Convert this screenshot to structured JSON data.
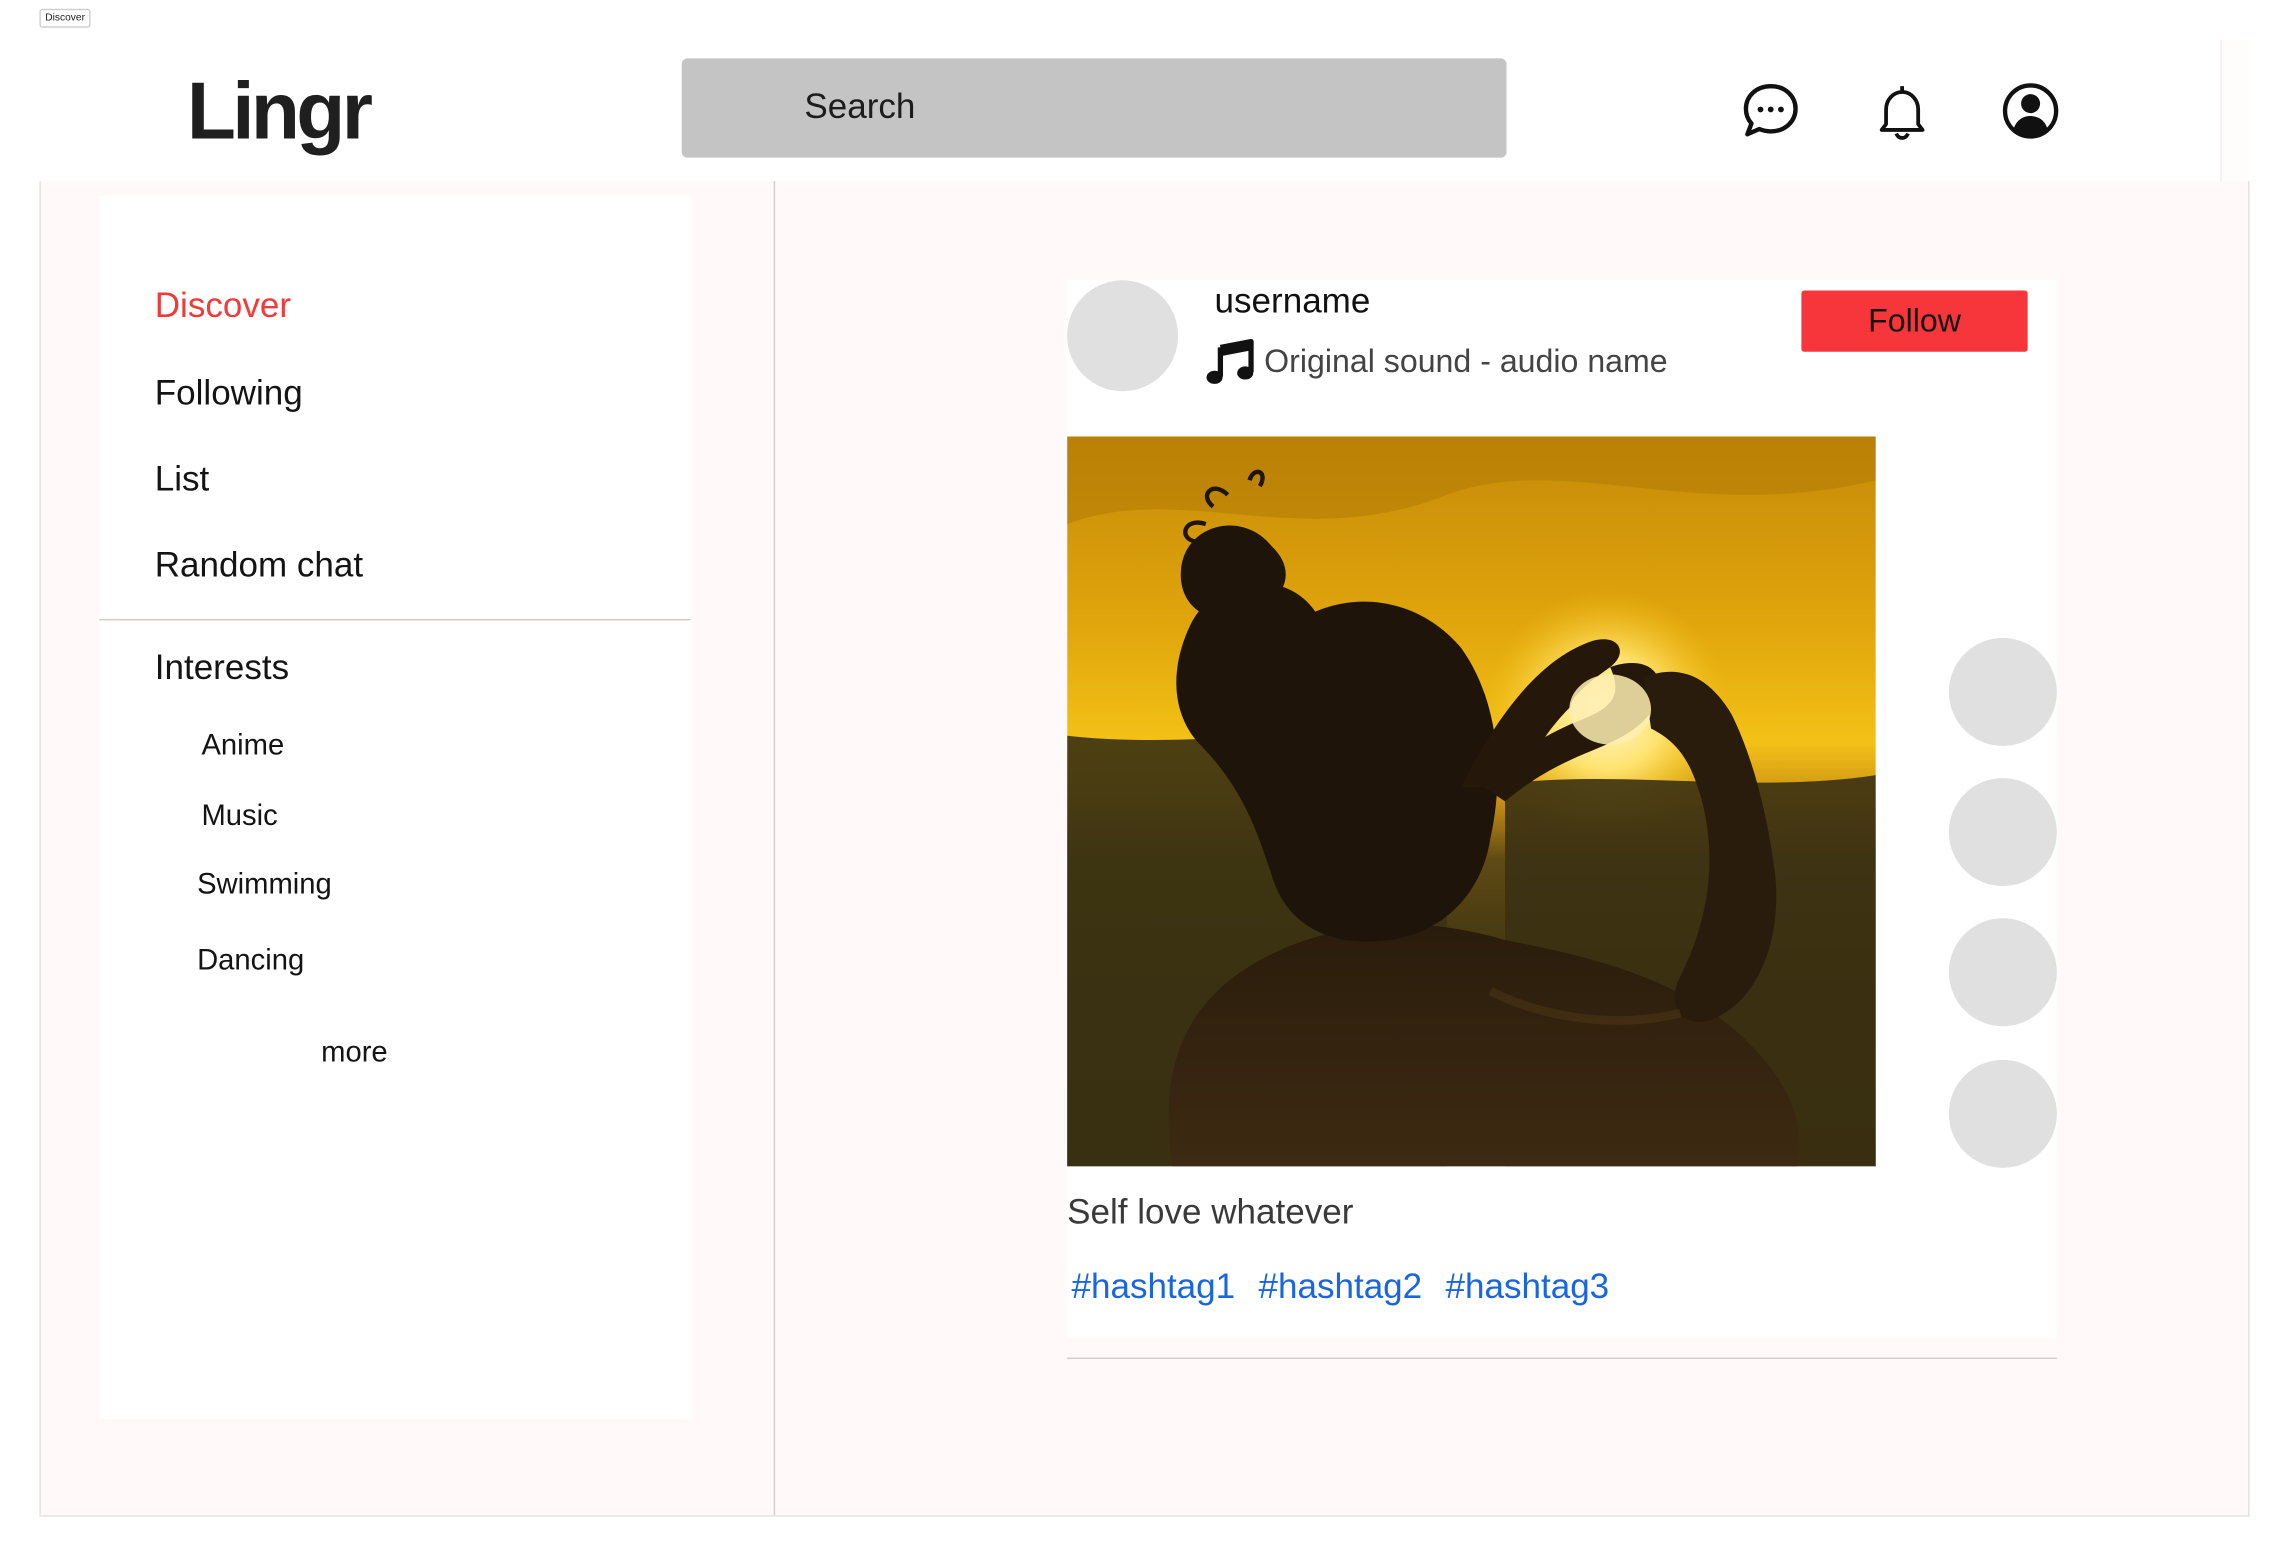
{
  "frame": {
    "label": "Discover"
  },
  "header": {
    "logo": "Lingr",
    "search_label": "Search",
    "icons": [
      "chat-bubble-icon",
      "bell-icon",
      "user-circle-icon"
    ]
  },
  "sidebar": {
    "nav": [
      {
        "label": "Discover",
        "active": true
      },
      {
        "label": "Following"
      },
      {
        "label": "List"
      },
      {
        "label": "Random chat"
      }
    ],
    "interests_heading": "Interests",
    "interests": [
      "Anime",
      "Music",
      "Swimming",
      "Dancing"
    ],
    "more_label": "more"
  },
  "post": {
    "username": "username",
    "audio": "Original sound - audio name",
    "follow_label": "Follow",
    "caption": "Self love whatever",
    "hashtags": [
      "#hashtag1",
      "#hashtag2",
      "#hashtag3"
    ]
  },
  "colors": {
    "accent": "#f23a3a",
    "follow_button": "#f7363b",
    "hashtag": "#1a66e0",
    "search_bg": "#c4c4c4",
    "placeholder": "#e0e0e0"
  }
}
